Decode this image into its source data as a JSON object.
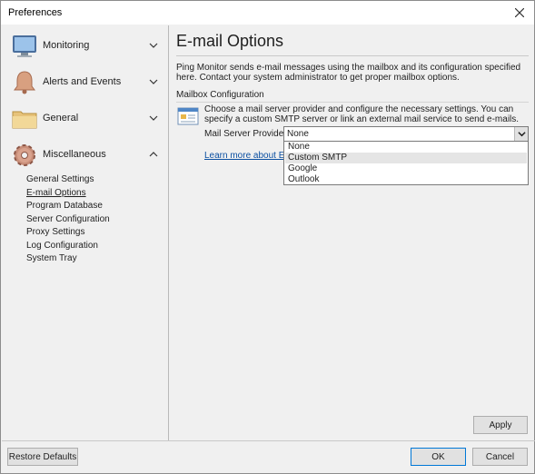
{
  "window": {
    "title": "Preferences"
  },
  "sidebar": {
    "categories": [
      {
        "label": "Monitoring",
        "icon": "monitor-icon",
        "expanded": false
      },
      {
        "label": "Alerts and Events",
        "icon": "bell-icon",
        "expanded": false
      },
      {
        "label": "General",
        "icon": "folder-icon",
        "expanded": false
      },
      {
        "label": "Miscellaneous",
        "icon": "gear-icon",
        "expanded": true
      }
    ],
    "subitems": [
      "General Settings",
      "E-mail Options",
      "Program Database",
      "Server Configuration",
      "Proxy Settings",
      "Log Configuration",
      "System Tray"
    ],
    "active_subitem": "E-mail Options"
  },
  "content": {
    "heading": "E-mail Options",
    "description": "Ping Monitor sends e-mail messages using the mailbox and its configuration specified here. Contact your system administrator to get proper mailbox options.",
    "section_title": "Mailbox Configuration",
    "mailbox_text": "Choose a mail server provider and configure the necessary settings. You can specify a custom SMTP server or link an external mail service to send e-mails.",
    "provider_label": "Mail Server Provider:",
    "provider_value": "None",
    "provider_options": [
      "None",
      "Custom SMTP",
      "Google",
      "Outlook"
    ],
    "hovered_option": "Custom SMTP",
    "learn_link": "Learn more about E-m",
    "apply_label": "Apply"
  },
  "footer": {
    "restore_label": "Restore Defaults",
    "ok_label": "OK",
    "cancel_label": "Cancel"
  },
  "colors": {
    "accent": "#0078d7",
    "link": "#0b4fa1",
    "hover": "#e5e5e5"
  }
}
